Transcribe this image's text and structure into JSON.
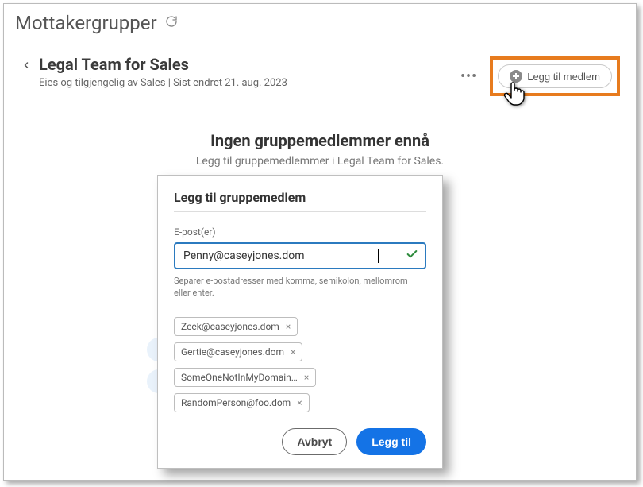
{
  "page": {
    "title": "Mottakergrupper"
  },
  "group": {
    "name": "Legal Team for Sales",
    "meta": "Eies og tilgjengelig av Sales | Sist endret 21. aug. 2023"
  },
  "actions": {
    "add_member_label": "Legg til medlem"
  },
  "empty_state": {
    "title": "Ingen gruppemedlemmer ennå",
    "subtitle": "Legg til gruppemedlemmer i Legal Team for Sales."
  },
  "dialog": {
    "title": "Legg til gruppemedlem",
    "email_label": "E-post(er)",
    "email_value": "Penny@caseyjones.dom",
    "helper": "Separer e-postadresser med komma, semikolon, mellomrom eller enter.",
    "chips": [
      "Zeek@caseyjones.dom",
      "Gertie@caseyjones.dom",
      "SomeOneNotInMyDomain…",
      "RandomPerson@foo.dom"
    ],
    "cancel_label": "Avbryt",
    "submit_label": "Legg til"
  }
}
